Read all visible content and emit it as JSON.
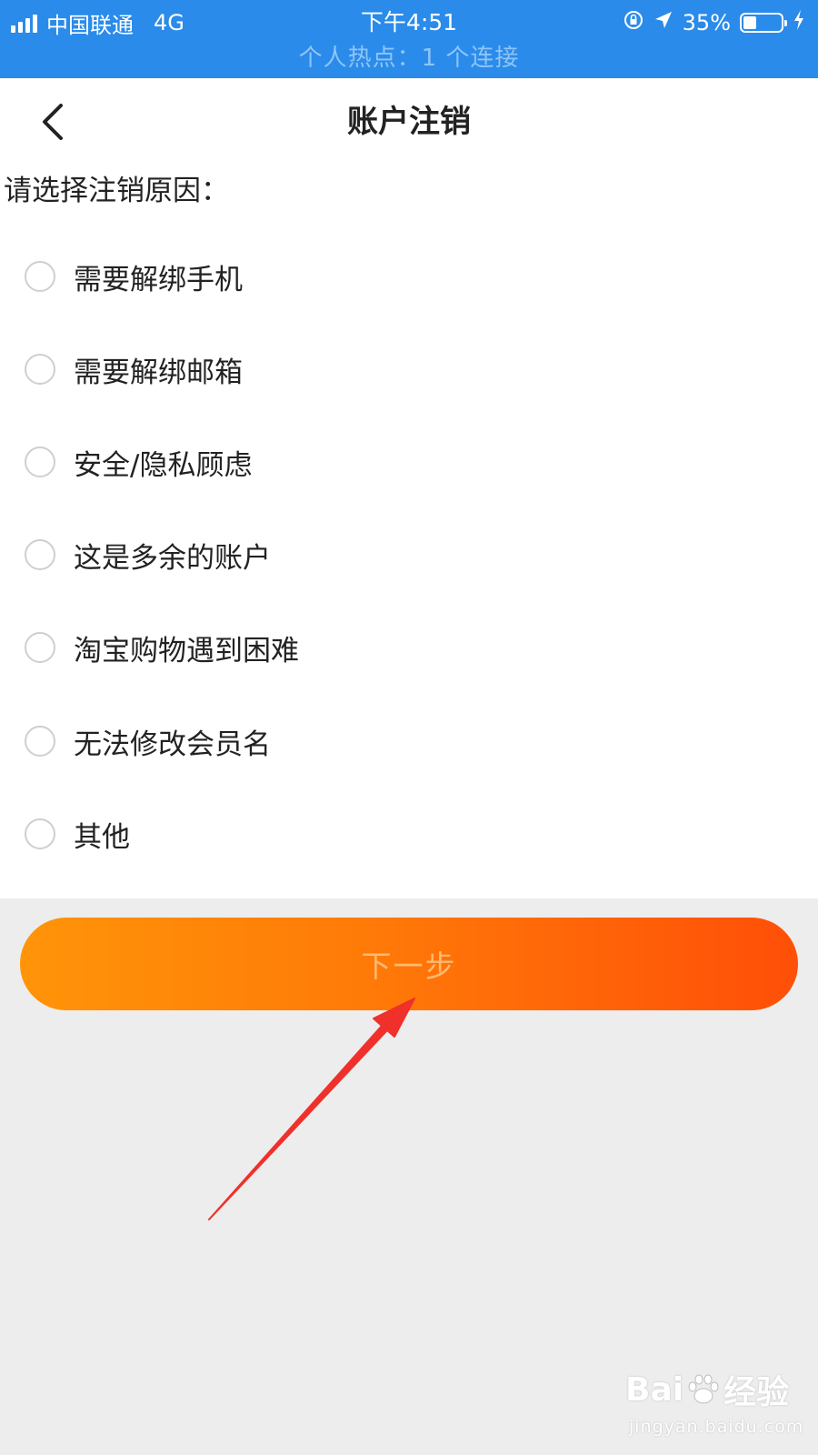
{
  "status_bar": {
    "carrier": "中国联通",
    "network": "4G",
    "time": "下午4:51",
    "battery_percent": "35%",
    "battery_level": 0.35,
    "hotspot": "个人热点：1 个连接"
  },
  "nav": {
    "title": "账户注销"
  },
  "form": {
    "prompt": "请选择注销原因：",
    "options": [
      {
        "label": "需要解绑手机",
        "selected": false
      },
      {
        "label": "需要解绑邮箱",
        "selected": false
      },
      {
        "label": "安全/隐私顾虑",
        "selected": false
      },
      {
        "label": "这是多余的账户",
        "selected": false
      },
      {
        "label": "淘宝购物遇到困难",
        "selected": false
      },
      {
        "label": "无法修改会员名",
        "selected": false
      },
      {
        "label": "其他",
        "selected": false
      }
    ],
    "next_label": "下一步"
  },
  "watermark": {
    "brand_prefix": "Bai",
    "brand_suffix": "经验",
    "url": "jingyan.baidu.com"
  },
  "colors": {
    "status_bar": "#2a8bea",
    "button_start": "#ff9409",
    "button_end": "#ff4f08",
    "annotation_arrow": "#f0302a"
  }
}
